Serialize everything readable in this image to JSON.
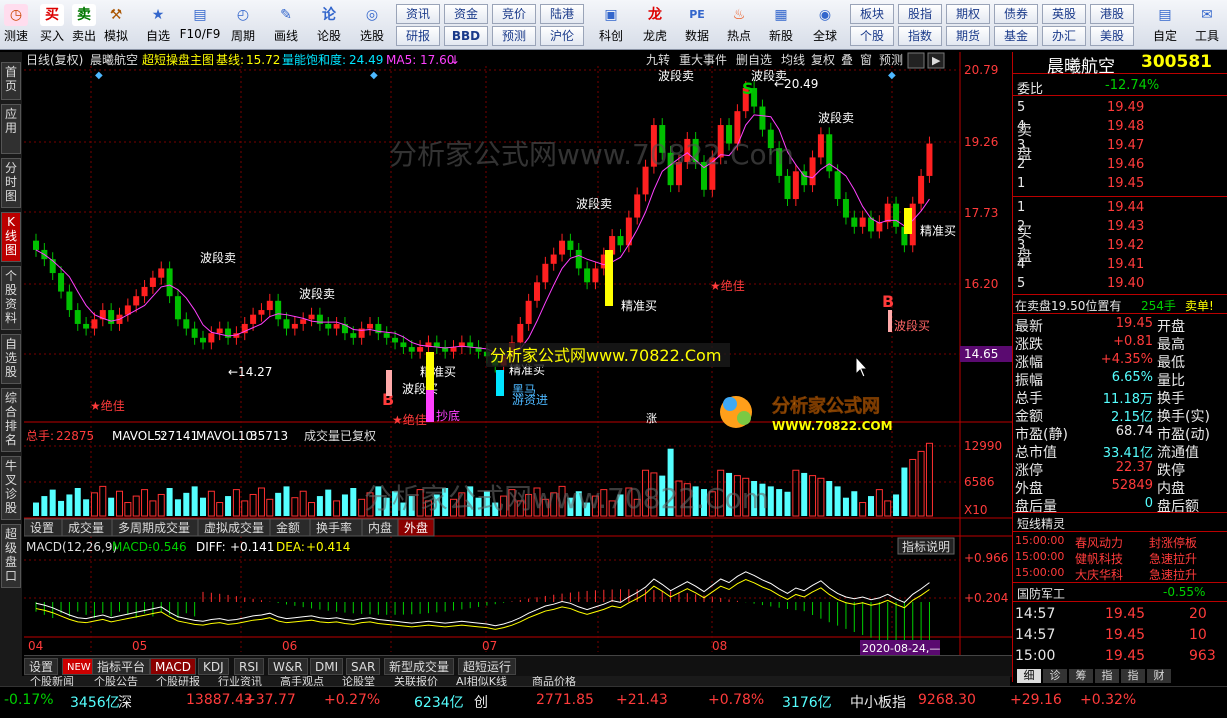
{
  "toolbar": {
    "tools": [
      {
        "label": "测速",
        "icon": "clock-icon"
      },
      {
        "label": "买入",
        "icon": "buy-icon"
      },
      {
        "label": "卖出",
        "icon": "sell-icon"
      },
      {
        "label": "模拟",
        "icon": "hammer-icon"
      },
      {
        "label": "自选",
        "icon": "star-icon"
      },
      {
        "label": "F10/F9",
        "icon": "f10-icon"
      },
      {
        "label": "周期",
        "icon": "period-icon"
      },
      {
        "label": "画线",
        "icon": "pencil-icon"
      },
      {
        "label": "论股",
        "icon": "discuss-icon"
      },
      {
        "label": "选股",
        "icon": "select-icon"
      }
    ],
    "group1": [
      "资讯",
      "资金",
      "竞价",
      "陆港",
      "研报",
      "BBD",
      "预测",
      "沪伦"
    ],
    "tools2": [
      {
        "label": "科创",
        "icon": "chart-icon"
      },
      {
        "label": "龙虎",
        "icon": "dragon-icon"
      },
      {
        "label": "数据",
        "icon": "pe-icon"
      },
      {
        "label": "热点",
        "icon": "hot-icon"
      },
      {
        "label": "新股",
        "icon": "newstock-icon"
      },
      {
        "label": "全球",
        "icon": "globe-icon"
      }
    ],
    "group2": [
      "板块",
      "股指",
      "期权",
      "债券",
      "英股",
      "港股",
      "个股",
      "指数",
      "期货",
      "基金",
      "办汇",
      "美股"
    ],
    "tools3": [
      {
        "label": "自定",
        "icon": "custom-icon"
      },
      {
        "label": "工具",
        "icon": "tools-icon"
      }
    ]
  },
  "left_tabs": [
    "首页",
    "应用",
    "分时图",
    "K线图",
    "个股资料",
    "自选股",
    "综合排名",
    "牛叉诊股",
    "超级盘口"
  ],
  "chart": {
    "header": "日线(复权)",
    "name": "晨曦航空",
    "title": "超短操盘主图",
    "base_label": "基线:",
    "base_val": "15.72",
    "vol_label": "量能饱和度:",
    "vol_val": "24.49",
    "ma5_label": "MA5:",
    "ma5_val": "17.60",
    "top_buttons": [
      "九转",
      "重大事件",
      "删自选",
      "均线",
      "复权",
      "叠",
      "窗",
      "预测"
    ],
    "price_axis": [
      "20.79",
      "19.26",
      "17.73",
      "16.20",
      "14.65"
    ],
    "annotations": {
      "sell": "波段卖",
      "buy": "精准买",
      "best": "★绝佳",
      "low": "←14.27",
      "high": "←20.49",
      "band_buy": "波段买",
      "dip": "抄底",
      "black": "黑马",
      "youzi": "游资进",
      "zhang": "涨",
      "wave_sell2": "波段买",
      "s": "S",
      "b": "B",
      "watermark1": "分析家公式网www.70822.Com",
      "watermark2": "分析家公式网www.70822.Com",
      "logo": "分析家公式网",
      "logo2": "WWW.70822.COM"
    },
    "volume": {
      "label": "总手:",
      "val": "22875",
      "ma5_label": "MAVOL5:",
      "ma5": "27141",
      "ma10_label": "MAVOL10:",
      "ma10": "35713",
      "note": "成交量已复权",
      "axis": [
        "12990",
        "6586",
        "X10"
      ]
    },
    "vol_tabs": [
      "设置",
      "成交量",
      "多周期成交量",
      "虚拟成交量",
      "金额",
      "换手率",
      "内盘",
      "外盘"
    ],
    "macd": {
      "label": "MACD(12,26,9)",
      "macd_label": "MACD:",
      "macd": "-0.546",
      "diff_label": "DIFF:",
      "diff": "+0.141",
      "dea_label": "DEA:",
      "dea": "+0.414",
      "help": "指标说明",
      "axis": [
        "+0.966",
        "+0.204"
      ]
    },
    "date_axis": [
      "04",
      "05",
      "06",
      "07",
      "08"
    ],
    "cursor_date": "2020-08-24,—"
  },
  "bottom_tabs": [
    "设置",
    "NEW",
    "指标平台",
    "MACD",
    "KDJ",
    "RSI",
    "W&R",
    "DMI",
    "SAR",
    "新型成交量",
    "超短运行"
  ],
  "bottom_tabs2": [
    "个股新闻",
    "个股公告",
    "个股研报",
    "行业资讯",
    "高手观点",
    "论股堂",
    "关联报价",
    "AI相似K线",
    "商品价格"
  ],
  "quote": {
    "name": "晨曦航空",
    "code": "300581",
    "weibi_label": "委比",
    "weibi": "-12.74%",
    "sell_label": "卖盘",
    "buy_label": "买盘",
    "sell": [
      [
        "5",
        "19.49"
      ],
      [
        "4",
        "19.48"
      ],
      [
        "3",
        "19.47"
      ],
      [
        "2",
        "19.46"
      ],
      [
        "1",
        "19.45"
      ]
    ],
    "buy": [
      [
        "1",
        "19.44"
      ],
      [
        "2",
        "19.43"
      ],
      [
        "3",
        "19.42"
      ],
      [
        "4",
        "19.41"
      ],
      [
        "5",
        "19.40"
      ]
    ],
    "trade_msg": "在卖盘19.50位置有",
    "trade_qty": "254手",
    "trade_tag": "卖单!",
    "stats": [
      {
        "l": "最新",
        "v": "19.45",
        "c": "red",
        "l2": "开盘"
      },
      {
        "l": "涨跌",
        "v": "+0.81",
        "c": "red",
        "l2": "最高"
      },
      {
        "l": "涨幅",
        "v": "+4.35%",
        "c": "red",
        "l2": "最低"
      },
      {
        "l": "振幅",
        "v": "6.65%",
        "c": "cyan",
        "l2": "量比"
      },
      {
        "l": "总手",
        "v": "11.18万",
        "c": "cyan",
        "l2": "换手"
      },
      {
        "l": "金额",
        "v": "2.15亿",
        "c": "cyan",
        "l2": "换手(实)"
      },
      {
        "l": "市盈(静)",
        "v": "68.74",
        "c": "white",
        "l2": "市盈(动)"
      },
      {
        "l": "总市值",
        "v": "33.41亿",
        "c": "cyan",
        "l2": "流通值"
      },
      {
        "l": "涨停",
        "v": "22.37",
        "c": "red",
        "l2": "跌停"
      },
      {
        "l": "外盘",
        "v": "52849",
        "c": "red",
        "l2": "内盘"
      },
      {
        "l": "盘后量",
        "v": "0",
        "c": "cyan",
        "l2": "盘后额"
      }
    ],
    "jingling_title": "短线精灵",
    "jingling": [
      [
        "15:00:00",
        "春风动力",
        "封涨停板"
      ],
      [
        "15:00:00",
        "健帆科技",
        "急速拉升"
      ],
      [
        "15:00:00",
        "大庆华科",
        "急速拉升"
      ]
    ],
    "sector": "国防军工",
    "sector_pct": "-0.55%",
    "ticks": [
      [
        "14:57",
        "19.45",
        "20"
      ],
      [
        "14:57",
        "19.45",
        "10"
      ],
      [
        "15:00",
        "19.45",
        "963"
      ]
    ],
    "tick_tabs": [
      "细",
      "诊",
      "筹",
      "指",
      "指",
      "财"
    ]
  },
  "status": [
    {
      "t": "-0.17%",
      "c": "green"
    },
    {
      "t": "3456亿",
      "c": "cyan"
    },
    {
      "t": "深",
      "c": "white"
    },
    {
      "t": "13887.43",
      "c": "red"
    },
    {
      "t": "+37.77",
      "c": "red"
    },
    {
      "t": "+0.27%",
      "c": "red"
    },
    {
      "t": "6234亿",
      "c": "cyan"
    },
    {
      "t": "创",
      "c": "white"
    },
    {
      "t": "2771.85",
      "c": "red"
    },
    {
      "t": "+21.43",
      "c": "red"
    },
    {
      "t": "+0.78%",
      "c": "red"
    },
    {
      "t": "3176亿",
      "c": "cyan"
    },
    {
      "t": "中小板指",
      "c": "white"
    },
    {
      "t": "9268.30",
      "c": "red"
    },
    {
      "t": "+29.16",
      "c": "red"
    },
    {
      "t": "+0.32%",
      "c": "red"
    }
  ]
}
